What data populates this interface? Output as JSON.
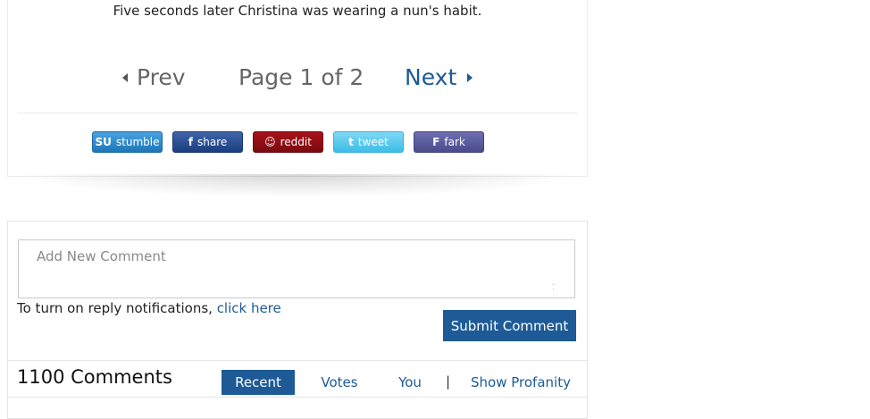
{
  "article": {
    "caption": "Five seconds later Christina was wearing a nun's habit.",
    "pager": {
      "prev_label": "Prev",
      "page_info": "Page 1 of 2",
      "next_label": "Next"
    },
    "share_buttons": [
      {
        "icon": "stumbleupon-icon",
        "glyph": "SU",
        "label": "stumble"
      },
      {
        "icon": "facebook-icon",
        "glyph": "f",
        "label": "share"
      },
      {
        "icon": "reddit-icon",
        "glyph": "☺",
        "label": "reddit"
      },
      {
        "icon": "twitter-icon",
        "glyph": "t",
        "label": "tweet"
      },
      {
        "icon": "fark-icon",
        "glyph": "F",
        "label": "fark"
      }
    ]
  },
  "comments": {
    "input_placeholder": "Add New Comment",
    "notify_text": "To turn on reply notifications, ",
    "notify_link": "click here",
    "submit_label": "Submit Comment",
    "count_label": "1100 Comments",
    "tabs": {
      "recent": "Recent",
      "votes": "Votes",
      "you": "You",
      "separator": "|",
      "profanity": "Show Profanity"
    }
  },
  "colors": {
    "link_blue": "#1d5a96",
    "stumble": "#2f8ccc",
    "facebook": "#2d4f93",
    "reddit": "#8e0d14",
    "twitter": "#55c7ee",
    "fark": "#5b5c9e"
  }
}
